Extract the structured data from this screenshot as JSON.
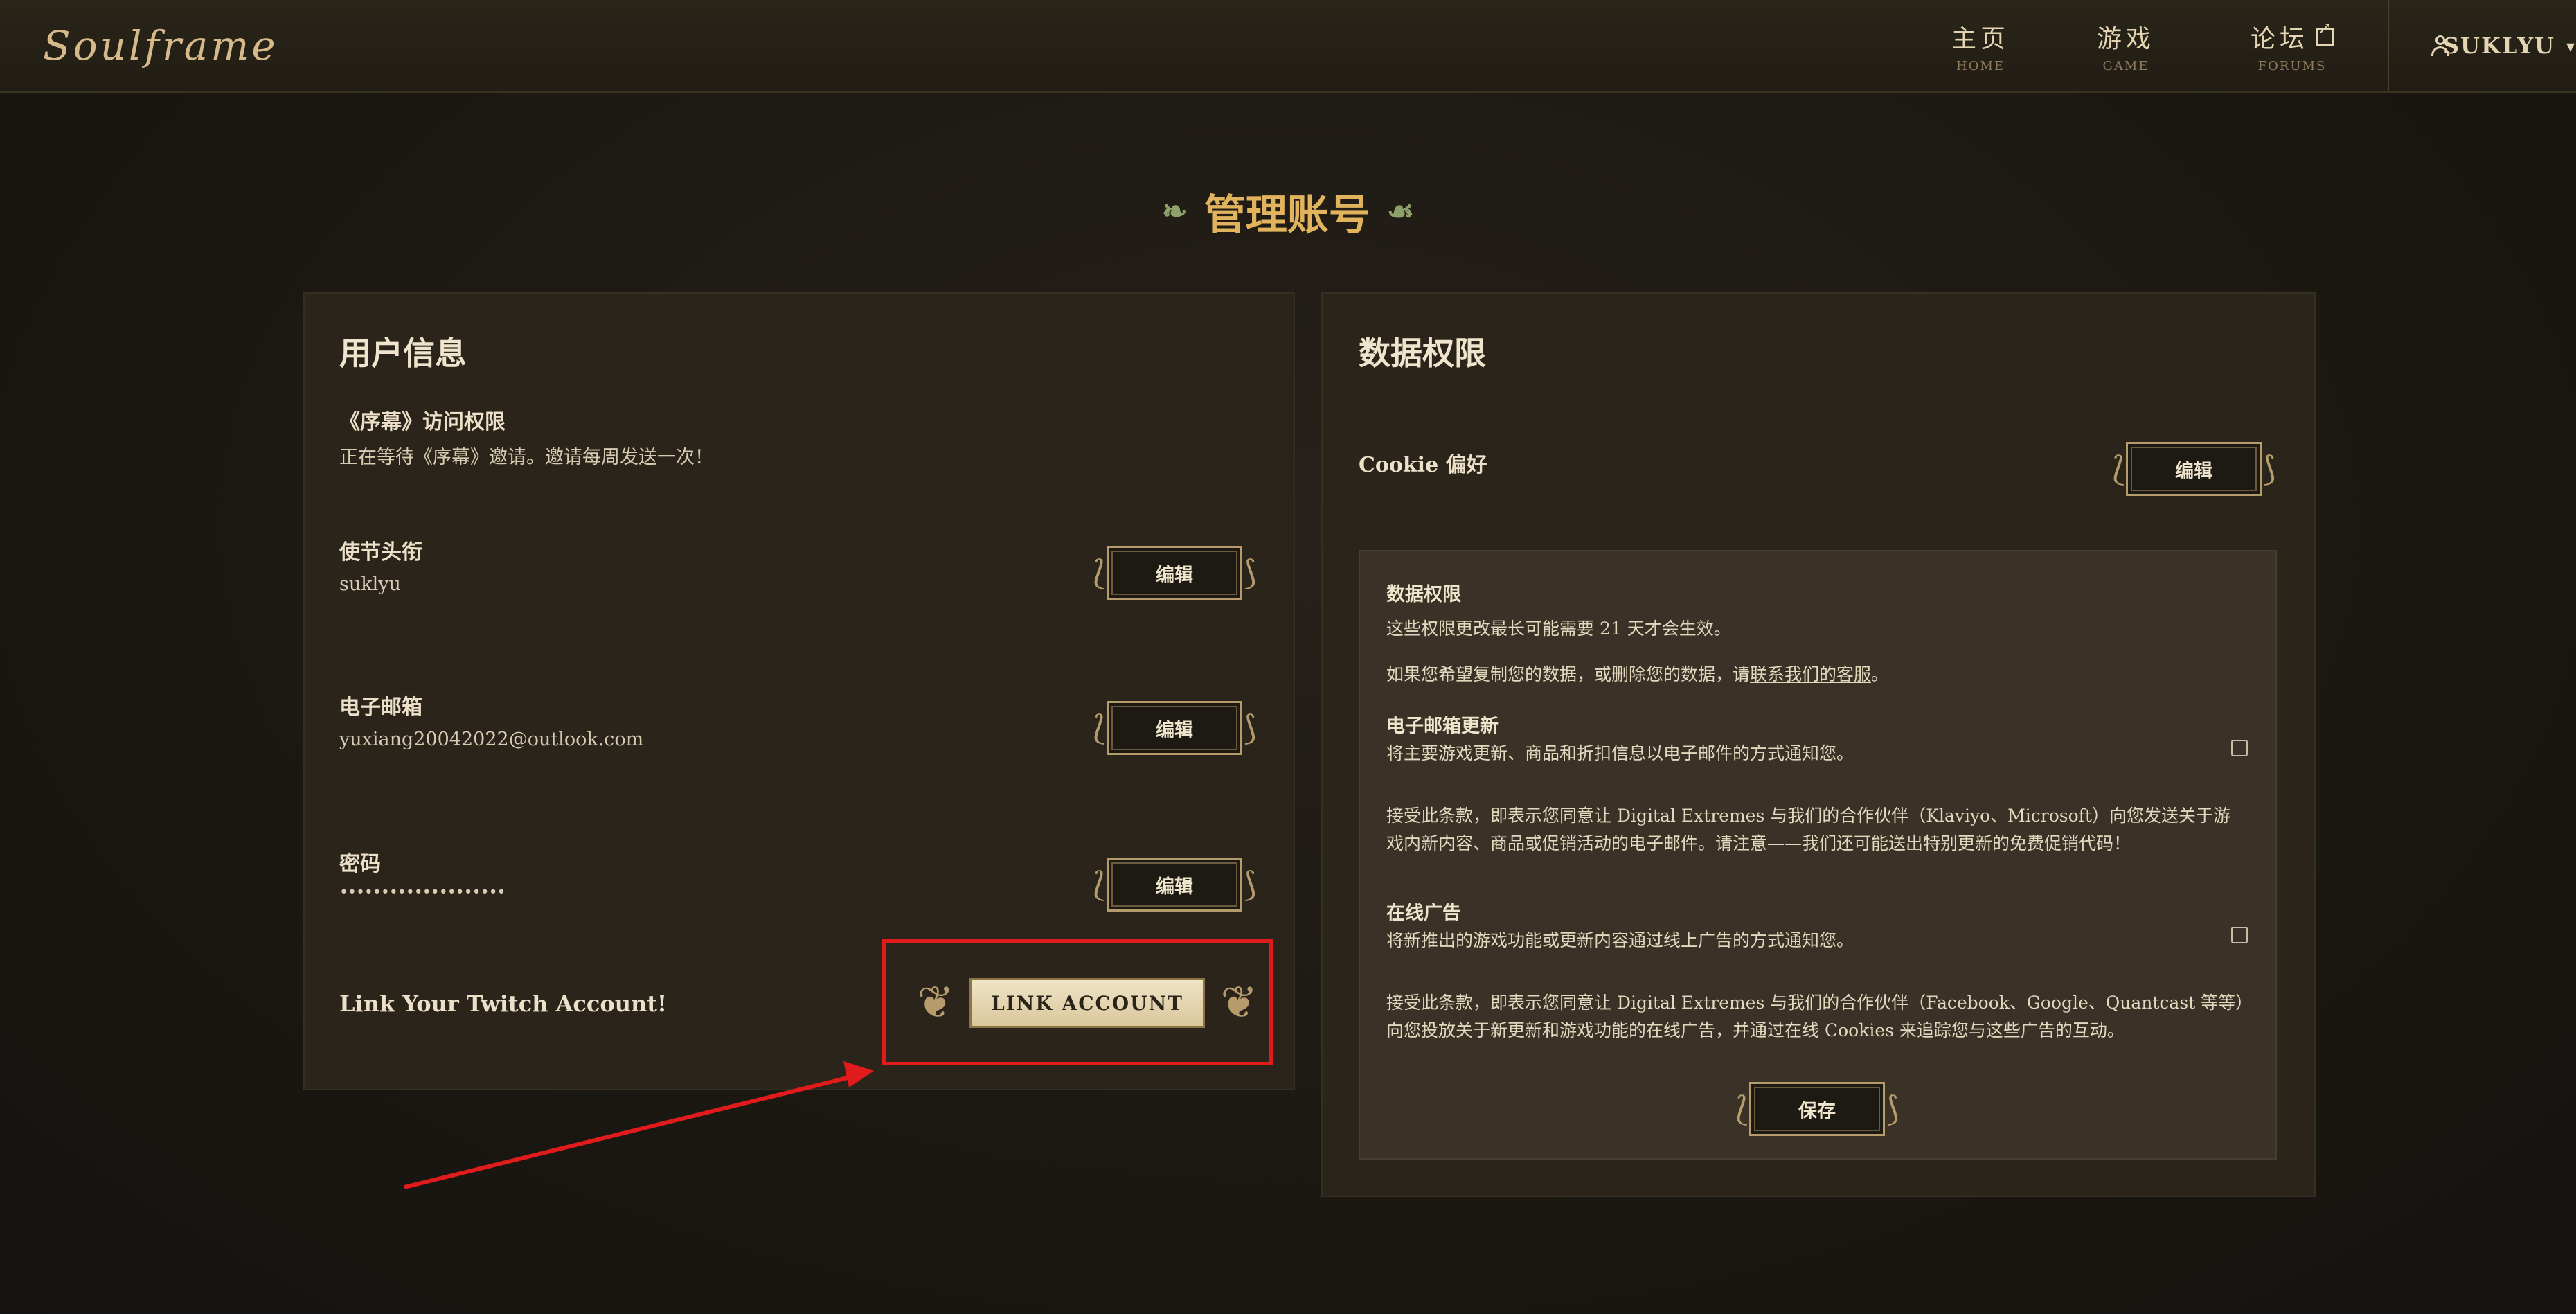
{
  "header": {
    "logo": "Soulframe",
    "nav": [
      {
        "label": "主页",
        "sub": "HOME"
      },
      {
        "label": "游戏",
        "sub": "GAME"
      },
      {
        "label": "论坛",
        "sub": "FORUMS"
      }
    ],
    "user": "SUKLYU"
  },
  "page": {
    "title": "管理账号"
  },
  "user_info": {
    "heading": "用户信息",
    "prelude_label": "《序幕》访问权限",
    "prelude_value": "正在等待《序幕》邀请。邀请每周发送一次！",
    "envoy_label": "使节头衔",
    "envoy_value": "suklyu",
    "email_label": "电子邮箱",
    "email_value": "yuxiang20042022@outlook.com",
    "password_label": "密码",
    "password_value": "••••••••••••••••••••",
    "edit_label": "编辑",
    "twitch_label": "Link Your Twitch Account!",
    "link_button": "LINK ACCOUNT"
  },
  "data_rights": {
    "heading": "数据权限",
    "cookie_label": "Cookie 偏好",
    "edit_label": "编辑",
    "box_title": "数据权限",
    "box_line1": "这些权限更改最长可能需要 21 天才会生效。",
    "box_line2_prefix": "如果您希望复制您的数据，或删除您的数据，请",
    "box_line2_link": "联系我们的客服",
    "box_line2_suffix": "。",
    "email_updates_title": "电子邮箱更新",
    "email_updates_desc": "将主要游戏更新、商品和折扣信息以电子邮件的方式通知您。",
    "email_updates_terms": "接受此条款，即表示您同意让 Digital Extremes 与我们的合作伙伴（Klaviyo、Microsoft）向您发送关于游戏内新内容、商品或促销活动的电子邮件。请注意——我们还可能送出特别更新的免费促销代码！",
    "ads_title": "在线广告",
    "ads_desc": "将新推出的游戏功能或更新内容通过线上广告的方式通知您。",
    "ads_terms": "接受此条款，即表示您同意让 Digital Extremes 与我们的合作伙伴（Facebook、Google、Quantcast 等等）向您投放关于新更新和游戏功能的在线广告，并通过在线 Cookies 来追踪您与这些广告的互动。",
    "save_label": "保存"
  },
  "colors": {
    "accent": "#e0b35c",
    "highlight": "#e01b1b"
  }
}
